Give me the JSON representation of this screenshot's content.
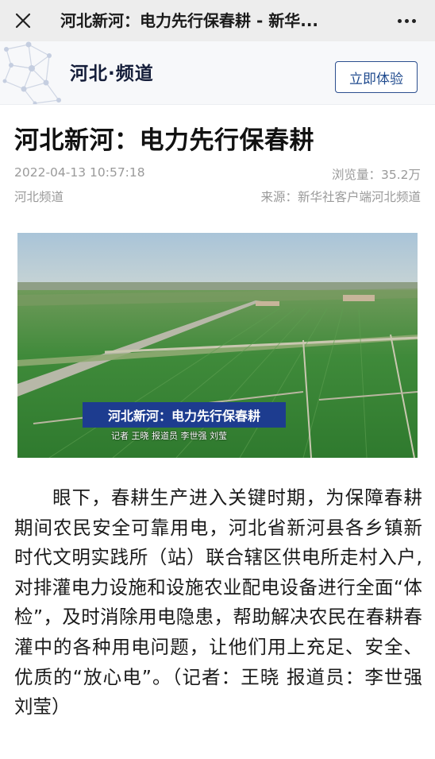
{
  "topbar": {
    "title": "河北新河：电力先行保春耕 - 新华...",
    "close_icon": "close-icon",
    "more_icon": "more-dots-icon"
  },
  "channel": {
    "name": "河北·频道",
    "try_button": "立即体验",
    "accent": "#1f4a8e"
  },
  "article": {
    "title": "河北新河：电力先行保春耕",
    "date": "2022-04-13 10:57:18",
    "views": "浏览量：35.2万",
    "channel": "河北频道",
    "source": "来源：新华社客户端河北频道",
    "image": {
      "caption": "河北新河：电力先行保春耕",
      "credit": "记者 王晓 报道员 李世强 刘莹"
    },
    "body": "眼下，春耕生产进入关键时期，为保障春耕期间农民安全可靠用电，河北省新河县各乡镇新时代文明实践所（站）联合辖区供电所走村入户,对排灌电力设施和设施农业配电设备进行全面“体检”，及时消除用电隐患，帮助解决农民在春耕春灌中的各种用电问题，让他们用上充足、安全、优质的“放心电”。（记者：王晓 报道员：李世强 刘莹）"
  }
}
